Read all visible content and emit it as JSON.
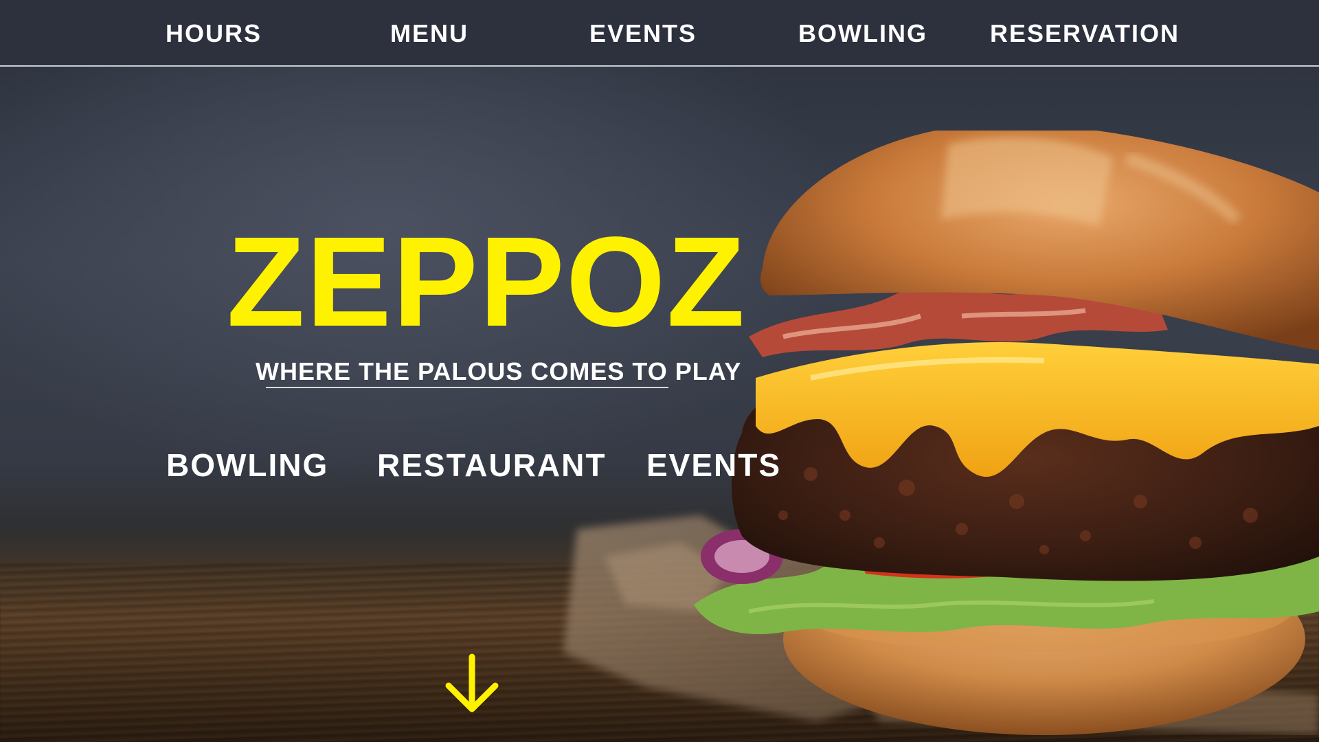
{
  "nav": {
    "items": [
      {
        "label": "HOURS"
      },
      {
        "label": "MENU"
      },
      {
        "label": "EVENTS"
      },
      {
        "label": "BOWLING"
      },
      {
        "label": "RESERVATION"
      }
    ]
  },
  "hero": {
    "brand": "ZEPPOZ",
    "tagline": "WHERE THE PALOUS COMES TO PLAY",
    "links": [
      {
        "label": "BOWLING"
      },
      {
        "label": "RESTAURANT"
      },
      {
        "label": "EVENTS"
      }
    ],
    "scroll_icon": "arrow-down-icon"
  },
  "colors": {
    "accent": "#fff200",
    "nav_background": "#2c313d",
    "text": "#ffffff"
  }
}
